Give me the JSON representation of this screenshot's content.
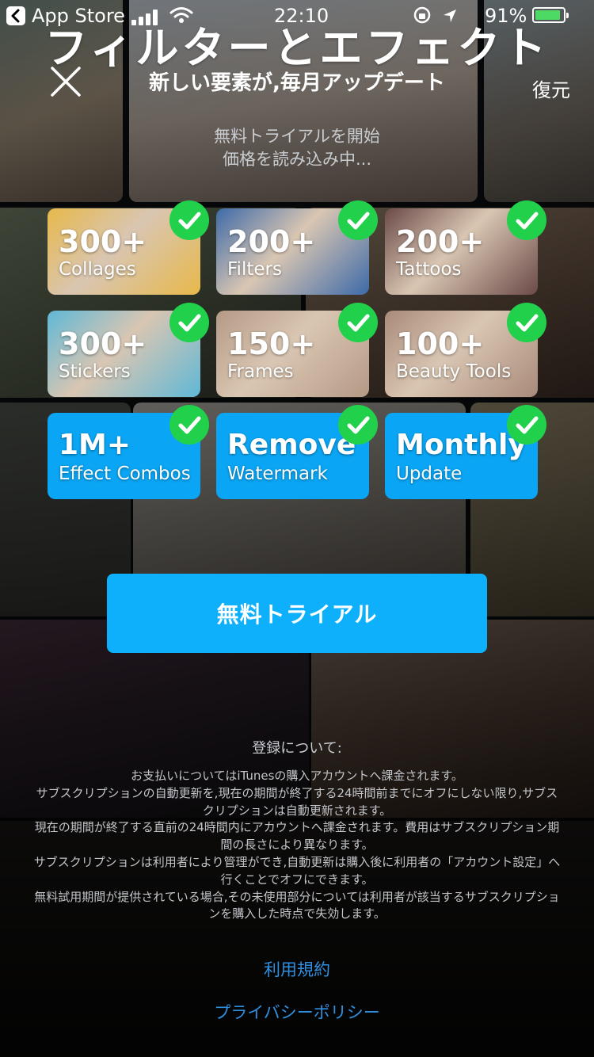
{
  "status_bar": {
    "back_app": "App Store",
    "time": "22:10",
    "battery_percent": "91%",
    "battery_level": 0.91
  },
  "header": {
    "title": "フィルターとエフェクト",
    "subtitle": "新しい要素が,毎月アップデート",
    "restore_label": "復元",
    "close_icon": "close-icon"
  },
  "trial_info": {
    "line1": "無料トライアルを開始",
    "line2": "価格を読み込み中..."
  },
  "features": [
    {
      "big": "300+",
      "small": "Collages",
      "style": "photo",
      "accent": "#e7b84a"
    },
    {
      "big": "200+",
      "small": "Filters",
      "style": "photo",
      "accent": "#3d6aa8"
    },
    {
      "big": "200+",
      "small": "Tattoos",
      "style": "photo",
      "accent": "#6b4a48"
    },
    {
      "big": "300+",
      "small": "Stickers",
      "style": "photo",
      "accent": "#5fb8d6"
    },
    {
      "big": "150+",
      "small": "Frames",
      "style": "photo",
      "accent": "#b59a86"
    },
    {
      "big": "100+",
      "small": "Beauty Tools",
      "style": "photo",
      "accent": "#a98a7a"
    },
    {
      "big": "1M+",
      "small": "Effect Combos",
      "style": "blue",
      "accent": "#0aa6f5"
    },
    {
      "big": "Remove",
      "small": "Watermark",
      "style": "blue",
      "accent": "#0aa6f5"
    },
    {
      "big": "Monthly",
      "small": "Update",
      "style": "blue",
      "accent": "#0aa6f5"
    }
  ],
  "cta": {
    "label": "無料トライアル",
    "color": "#0fb0fb"
  },
  "legal": {
    "heading": "登録について:",
    "lines": [
      "お支払いについてはiTunesの購入アカウントへ課金されます。",
      "サブスクリプションの自動更新を,現在の期間が終了する24時間前までにオフにしない限り,サブスクリプションは自動更新されます。",
      "現在の期間が終了する直前の24時間内にアカウントへ課金されます。費用はサブスクリプション期間の長さにより異なります。",
      "サブスクリプションは利用者により管理ができ,自動更新は購入後に利用者の「アカウント設定」へ行くことでオフにできます。",
      "無料試用期間が提供されている場合,その未使用部分については利用者が該当するサブスクリプションを購入した時点で失効します。"
    ]
  },
  "links": {
    "terms": "利用規約",
    "privacy": "プライバシーポリシー",
    "color": "#2f8fe0"
  },
  "colors": {
    "check": "#22d14b",
    "battery": "#4cd964"
  }
}
